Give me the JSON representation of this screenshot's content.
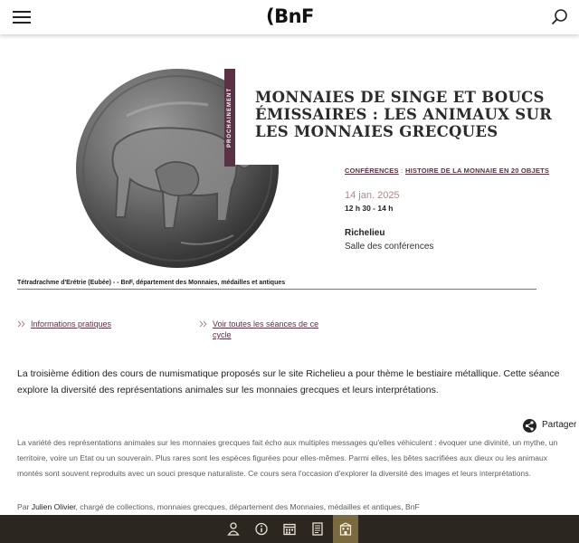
{
  "header": {
    "logo": "(BnF",
    "menu_icon": "hamburger-menu-icon",
    "search_icon": "search-icon"
  },
  "hero": {
    "badge": "PROCHAINEMENT",
    "title": "Monnaies de singe et boucs émissaires : les animaux sur les monnaies grecques",
    "category_1": "Conférences",
    "category_sep": " : ",
    "category_2": "Histoire de la monnaie en 20 objets",
    "date": "14 jan. 2025",
    "time": "12 h 30 - 14 h",
    "place": "Richelieu",
    "room": "Salle des conférences",
    "caption": "Tétradrachme d'Erétrie (Eubée) - - BnF, département des Monnaies, médailles et antiques"
  },
  "links": {
    "practical_info": "Informations pratiques",
    "all_sessions": "Voir toutes les séances de ce cycle"
  },
  "content": {
    "lead": "La troisième édition des cours de numismatique proposés sur le site Richelieu a pour thème le bestiaire métallique. Cette séance explore la diversité des représentations animales sur les monnaies grecques et leurs interprétations.",
    "share_label": "Partager",
    "body": "La variété des représentations animales sur les monnaies grecques fait écho aux multiples messages qu'elles véhiculent : évoquer une divinité, un mythe, un territoire, voire un Etat ou un souverain. Plus rares sont les espèces figurées pour elles-mêmes. Parmi elles, les bêtes sacrifiées aux dieux ou les animaux montés sont souvent reproduits avec un souci presque naturaliste. Ce cours sera l'occasion d'explorer la diversité des images et leurs interprétations.",
    "byline_prefix": "Par ",
    "byline_name": "Julien Olivier",
    "byline_rest": ", chargé de collections, monnaies grecques, département des Monnaies, médailles et antiques, BnF"
  },
  "bottom_bar": {
    "icons": [
      "visitor-icon",
      "info-icon",
      "calendar-icon",
      "document-icon",
      "building-icon"
    ],
    "active": "building-icon"
  },
  "colors": {
    "accent": "#5a3245",
    "date": "#a98b8b",
    "bottom_bar": "#2b2620",
    "bottom_active": "#7a6a3f"
  }
}
